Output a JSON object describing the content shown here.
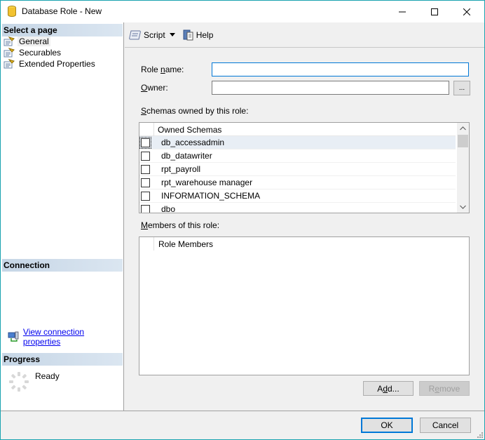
{
  "window": {
    "title": "Database Role - New"
  },
  "left_panel": {
    "select_page_header": "Select a page",
    "pages": [
      {
        "label": "General",
        "selected": true
      },
      {
        "label": "Securables",
        "selected": false
      },
      {
        "label": "Extended Properties",
        "selected": false
      }
    ],
    "connection_header": "Connection",
    "connection_link": "View connection properties",
    "progress_header": "Progress",
    "progress_status": "Ready"
  },
  "toolbar": {
    "script_label": "Script",
    "help_label": "Help"
  },
  "form": {
    "role_name_label_pre": "Role ",
    "role_name_label_key": "n",
    "role_name_label_post": "ame:",
    "role_name_value": "",
    "owner_label_key": "O",
    "owner_label_post": "wner:",
    "owner_value": "",
    "browse_label": "...",
    "schemas_label_key": "S",
    "schemas_label_post": "chemas owned by this role:",
    "schemas_column": "Owned Schemas",
    "schemas": [
      {
        "name": "db_accessadmin",
        "checked": false
      },
      {
        "name": "db_datawriter",
        "checked": false
      },
      {
        "name": "rpt_payroll",
        "checked": false
      },
      {
        "name": "rpt_warehouse manager",
        "checked": false
      },
      {
        "name": "INFORMATION_SCHEMA",
        "checked": false
      },
      {
        "name": "dbo",
        "checked": false
      }
    ],
    "members_label_key": "M",
    "members_label_post": "embers of this role:",
    "members_column": "Role Members",
    "add_pre": "A",
    "add_key": "d",
    "add_post": "d...",
    "remove_pre": "R",
    "remove_key": "e",
    "remove_post": "move"
  },
  "footer": {
    "ok_label": "OK",
    "cancel_label": "Cancel"
  }
}
